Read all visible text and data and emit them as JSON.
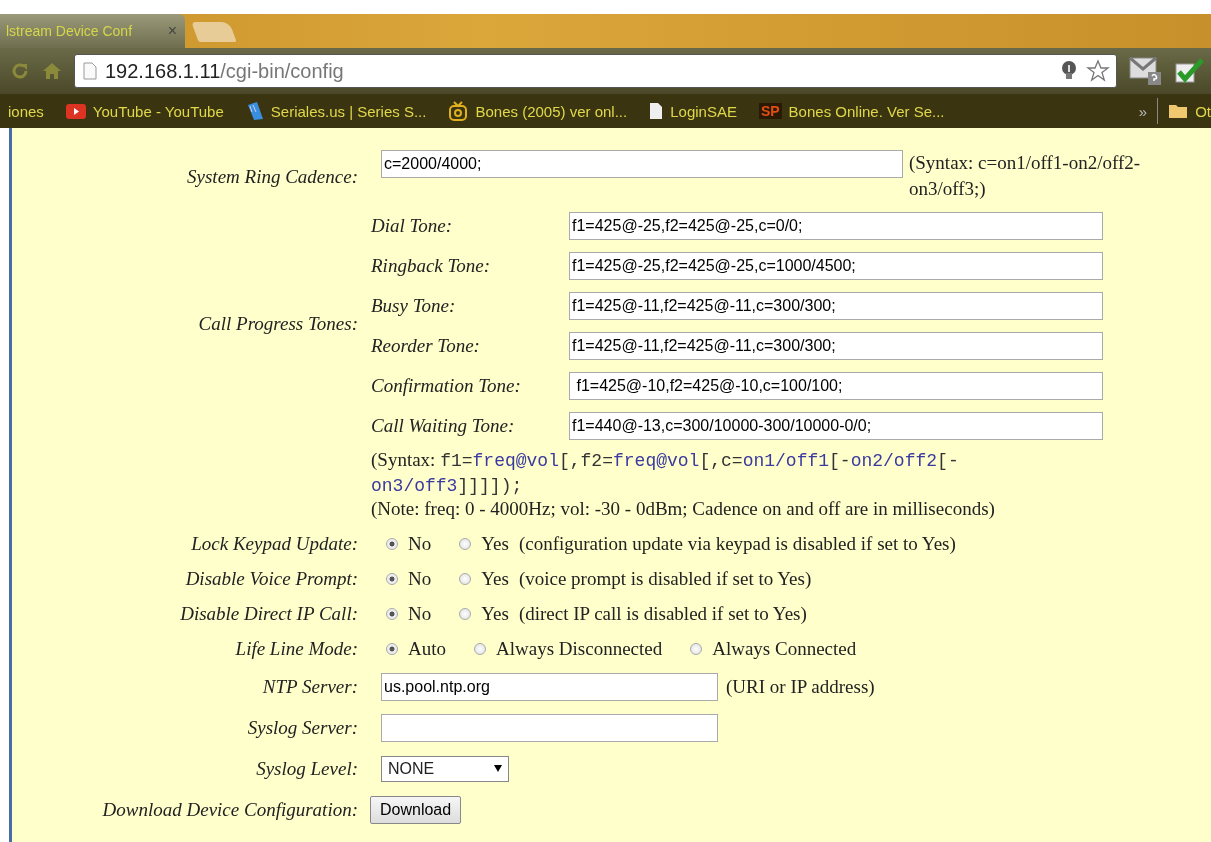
{
  "browser": {
    "tab": {
      "title": "lstream Device Conf",
      "close": "×"
    },
    "url": {
      "host": "192.168.1.11",
      "path": "/cgi-bin/config"
    },
    "bookmarks": [
      {
        "label": "iones",
        "kind": "plain"
      },
      {
        "label": "YouTube - YouTube",
        "kind": "video"
      },
      {
        "label": "Seriales.us | Series S...",
        "kind": "film"
      },
      {
        "label": "Bones (2005) ver onl...",
        "kind": "tv"
      },
      {
        "label": "LoginSAE",
        "kind": "page"
      },
      {
        "label": "Bones Online. Ver Se...",
        "kind": "badge",
        "icon_text": "SP"
      }
    ],
    "more": "»",
    "other": "Ot"
  },
  "form": {
    "ring_cadence": {
      "label": "System Ring Cadence:",
      "value": "c=2000/4000;",
      "note": "(Syntax: c=on1/off1-on2/off2-on3/off3;)"
    },
    "tones": {
      "label": "Call Progress Tones:",
      "items": [
        {
          "label": "Dial Tone:",
          "value": "f1=425@-25,f2=425@-25,c=0/0;"
        },
        {
          "label": "Ringback Tone:",
          "value": "f1=425@-25,f2=425@-25,c=1000/4500;"
        },
        {
          "label": "Busy Tone:",
          "value": "f1=425@-11,f2=425@-11,c=300/300;"
        },
        {
          "label": "Reorder Tone:",
          "value": "f1=425@-11,f2=425@-11,c=300/300;"
        },
        {
          "label": "Confirmation Tone:",
          "value": " f1=425@-10,f2=425@-10,c=100/100;"
        },
        {
          "label": "Call Waiting Tone:",
          "value": "f1=440@-13,c=300/10000-300/10000-0/0;"
        }
      ],
      "syntax": [
        {
          "kind": "plain",
          "text": "(Syntax: "
        },
        {
          "kind": "code",
          "text": "f1="
        },
        {
          "kind": "var",
          "text": "freq@vol"
        },
        {
          "kind": "code",
          "text": "[,f2="
        },
        {
          "kind": "var",
          "text": "freq@vol"
        },
        {
          "kind": "code",
          "text": "[,c="
        },
        {
          "kind": "var",
          "text": "on1/off1"
        },
        {
          "kind": "code",
          "text": "[-"
        },
        {
          "kind": "var",
          "text": "on2/off2"
        },
        {
          "kind": "code",
          "text": "[-"
        },
        {
          "kind": "var",
          "text": "on3/off3"
        },
        {
          "kind": "code",
          "text": "]]]]);"
        }
      ],
      "note": "(Note: freq: 0 - 4000Hz; vol: -30 - 0dBm; Cadence on and off are in milliseconds)"
    },
    "radio_rows": [
      {
        "label": "Lock Keypad Update:",
        "options": [
          {
            "label": "No",
            "selected": true
          },
          {
            "label": "Yes",
            "selected": false
          }
        ],
        "hint": "(configuration update via keypad is disabled if set to Yes)"
      },
      {
        "label": "Disable Voice Prompt:",
        "options": [
          {
            "label": "No",
            "selected": true
          },
          {
            "label": "Yes",
            "selected": false
          }
        ],
        "hint": "(voice prompt is disabled if set to Yes)"
      },
      {
        "label": "Disable Direct IP Call:",
        "options": [
          {
            "label": "No",
            "selected": true
          },
          {
            "label": "Yes",
            "selected": false
          }
        ],
        "hint": "(direct IP call is disabled if set to Yes)"
      },
      {
        "label": "Life Line Mode:",
        "options": [
          {
            "label": "Auto",
            "selected": true
          },
          {
            "label": "Always Disconnected",
            "selected": false
          },
          {
            "label": "Always Connected",
            "selected": false
          }
        ]
      }
    ],
    "ntp": {
      "label": "NTP Server:",
      "value": "us.pool.ntp.org",
      "hint": "(URI or IP address)"
    },
    "syslog_server": {
      "label": "Syslog Server:"
    },
    "syslog_level": {
      "label": "Syslog Level:",
      "value": "NONE"
    },
    "download": {
      "label": "Download Device Configuration:",
      "button": "Download"
    }
  }
}
